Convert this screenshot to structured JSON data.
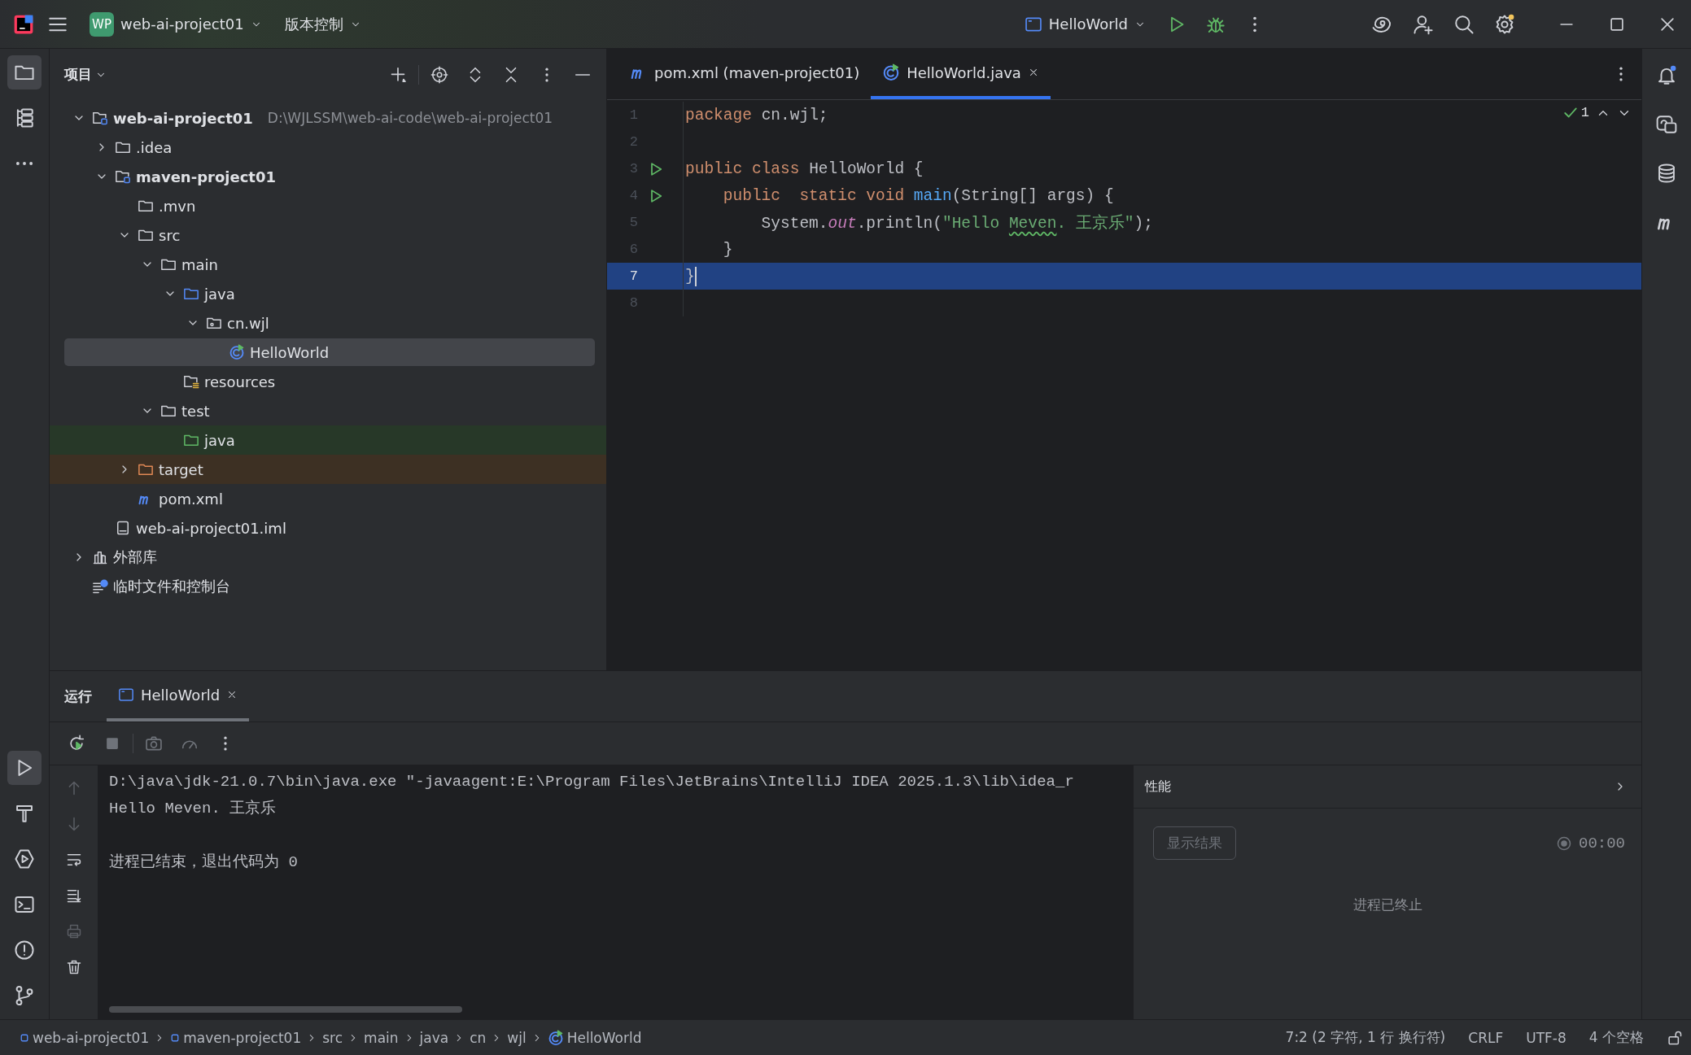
{
  "title_bar": {
    "project_badge": "WP",
    "project": "web-ai-project01",
    "vcs": "版本控制",
    "run_config": "HelloWorld"
  },
  "project_panel": {
    "title": "项目",
    "tree": [
      {
        "label": "web-ai-project01",
        "path": "D:\\WJLSSM\\web-ai-code\\web-ai-project01",
        "kind": "module",
        "expanded": true,
        "selected": false,
        "children": [
          {
            "label": ".idea",
            "kind": "folder",
            "expanded": false,
            "selected": false
          },
          {
            "label": "maven-project01",
            "kind": "module",
            "expanded": true,
            "selected": false,
            "children": [
              {
                "label": ".mvn",
                "kind": "folder",
                "selected": false
              },
              {
                "label": "src",
                "kind": "folder",
                "expanded": true,
                "selected": false,
                "children": [
                  {
                    "label": "main",
                    "kind": "folder",
                    "expanded": true,
                    "selected": false,
                    "children": [
                      {
                        "label": "java",
                        "kind": "source-folder",
                        "expanded": true,
                        "selected": false,
                        "children": [
                          {
                            "label": "cn.wjl",
                            "kind": "package",
                            "expanded": true,
                            "selected": false,
                            "children": [
                              {
                                "label": "HelloWorld",
                                "kind": "class",
                                "selected": true
                              }
                            ]
                          }
                        ]
                      },
                      {
                        "label": "resources",
                        "kind": "resource-folder",
                        "selected": false
                      }
                    ]
                  },
                  {
                    "label": "test",
                    "kind": "folder",
                    "expanded": true,
                    "selected": false,
                    "children": [
                      {
                        "label": "java",
                        "kind": "test-folder",
                        "selected": false
                      }
                    ]
                  }
                ]
              },
              {
                "label": "target",
                "kind": "excluded-folder",
                "expanded": false,
                "selected": false
              },
              {
                "label": "pom.xml",
                "kind": "maven",
                "selected": false
              }
            ]
          },
          {
            "label": "web-ai-project01.iml",
            "kind": "file",
            "selected": false
          }
        ]
      },
      {
        "label": "外部库",
        "kind": "library",
        "expanded": false,
        "selected": false
      },
      {
        "label": "临时文件和控制台",
        "kind": "scratch",
        "selected": false
      }
    ]
  },
  "editor": {
    "tabs": [
      {
        "label": "pom.xml (maven-project01)",
        "kind": "maven",
        "selected": false
      },
      {
        "label": "HelloWorld.java",
        "kind": "class",
        "selected": true
      }
    ],
    "inspection": "1",
    "lines": [
      {
        "number": "1",
        "run": false,
        "current": false,
        "tokens": [
          {
            "t": "package ",
            "kind": "keyword"
          },
          {
            "t": "cn.wjl;",
            "kind": "plain"
          }
        ]
      },
      {
        "number": "2",
        "run": false,
        "current": false
      },
      {
        "number": "3",
        "run": true,
        "current": false,
        "tokens": [
          {
            "t": "public class ",
            "kind": "keyword"
          },
          {
            "t": "HelloWorld {",
            "kind": "plain"
          }
        ]
      },
      {
        "number": "4",
        "run": true,
        "current": false,
        "tokens": [
          {
            "t": "    public  static void ",
            "kind": "keyword"
          },
          {
            "t": "main",
            "kind": "method"
          },
          {
            "t": "(String[] args) {",
            "kind": "plain"
          }
        ]
      },
      {
        "number": "5",
        "run": false,
        "current": false,
        "tokens": [
          {
            "t": "        System.",
            "kind": "plain"
          },
          {
            "t": "out",
            "kind": "field"
          },
          {
            "t": ".println(",
            "kind": "plain"
          },
          {
            "t": "\"Hello ",
            "kind": "string"
          },
          {
            "t": "Meven",
            "kind": "string-typo"
          },
          {
            "t": ". 王京乐\"",
            "kind": "string"
          },
          {
            "t": ");",
            "kind": "plain"
          }
        ]
      },
      {
        "number": "6",
        "run": false,
        "current": false,
        "tokens": [
          {
            "t": "    }",
            "kind": "plain"
          }
        ]
      },
      {
        "number": "7",
        "run": false,
        "current": true,
        "tokens": [
          {
            "t": "}",
            "kind": "plain"
          }
        ]
      },
      {
        "number": "8",
        "run": false,
        "current": false
      }
    ]
  },
  "run_panel": {
    "title": "运行",
    "tabs": [
      {
        "label": "HelloWorld",
        "selected": true
      }
    ],
    "console": [
      {
        "text": "D:\\java\\jdk-21.0.7\\bin\\java.exe \"-javaagent:E:\\Program Files\\JetBrains\\IntelliJ IDEA 2025.1.3\\lib\\idea_r"
      },
      {
        "text": "Hello Meven. 王京乐"
      },
      {
        "text": "进程已结束，退出代码为 0"
      }
    ],
    "performance": {
      "title": "性能",
      "button": "显示结果",
      "timer": "00:00",
      "status": "进程已终止"
    }
  },
  "status_bar": {
    "breadcrumbs": [
      {
        "label": "web-ai-project01",
        "kind": "module"
      },
      {
        "label": "maven-project01",
        "kind": "module"
      },
      {
        "label": "src",
        "kind": "folder"
      },
      {
        "label": "main",
        "kind": "folder"
      },
      {
        "label": "java",
        "kind": "folder"
      },
      {
        "label": "cn",
        "kind": "folder"
      },
      {
        "label": "wjl",
        "kind": "folder"
      },
      {
        "label": "HelloWorld",
        "kind": "class"
      }
    ],
    "items": [
      "7:2 (2 字符, 1 行 换行符)",
      "CRLF",
      "UTF-8",
      "4 个空格"
    ]
  }
}
